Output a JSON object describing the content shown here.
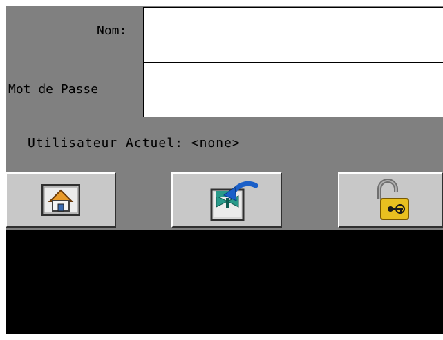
{
  "login": {
    "name_label": "Nom:",
    "password_label": "Mot de Passe",
    "name_value": "",
    "password_value": "",
    "current_user_label": "Utilisateur Actuel:",
    "current_user_value": "<none>"
  },
  "toolbar": {
    "buttons": [
      {
        "icon": "home-icon"
      },
      {
        "icon": "logout-arrow-icon"
      },
      {
        "icon": "unlock-icon"
      }
    ]
  },
  "colors": {
    "panel": "#808080",
    "button": "#c8c8c8",
    "field": "#ffffff",
    "footer": "#000000",
    "lock": "#e8c020",
    "arrow": "#1a5fc8",
    "teal": "#2a9a8a"
  }
}
